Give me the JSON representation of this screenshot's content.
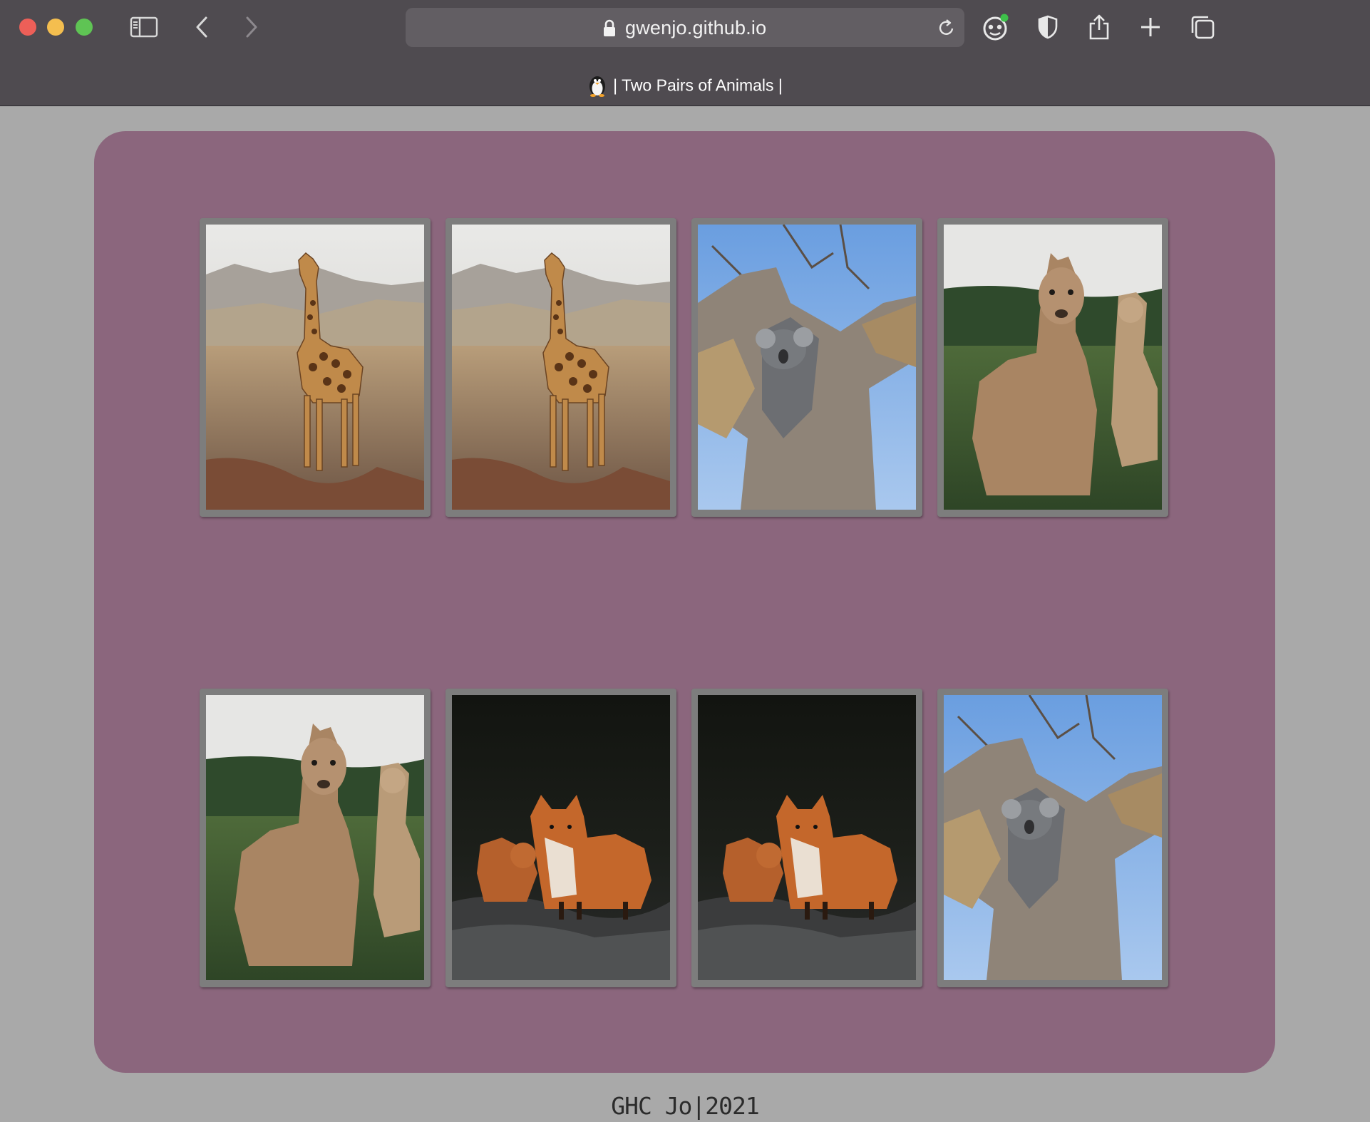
{
  "browser": {
    "url": "gwenjo.github.io",
    "tab_title": "| Two Pairs of Animals |",
    "icons": [
      "sidebar-icon",
      "back-icon",
      "forward-icon",
      "lock-icon",
      "reload-icon",
      "extension-icon",
      "privacy-shield-icon",
      "share-icon",
      "new-tab-icon",
      "tabs-overview-icon"
    ]
  },
  "colors": {
    "board": "#8b667d",
    "page_background": "#a9a9a9",
    "card_frame": "#7d7d7d"
  },
  "cards": [
    {
      "animal": "giraffe"
    },
    {
      "animal": "giraffe"
    },
    {
      "animal": "koala"
    },
    {
      "animal": "alpaca"
    },
    {
      "animal": "alpaca"
    },
    {
      "animal": "fox"
    },
    {
      "animal": "fox"
    },
    {
      "animal": "koala"
    }
  ],
  "footer": {
    "text": "GHC Jo|2021"
  }
}
